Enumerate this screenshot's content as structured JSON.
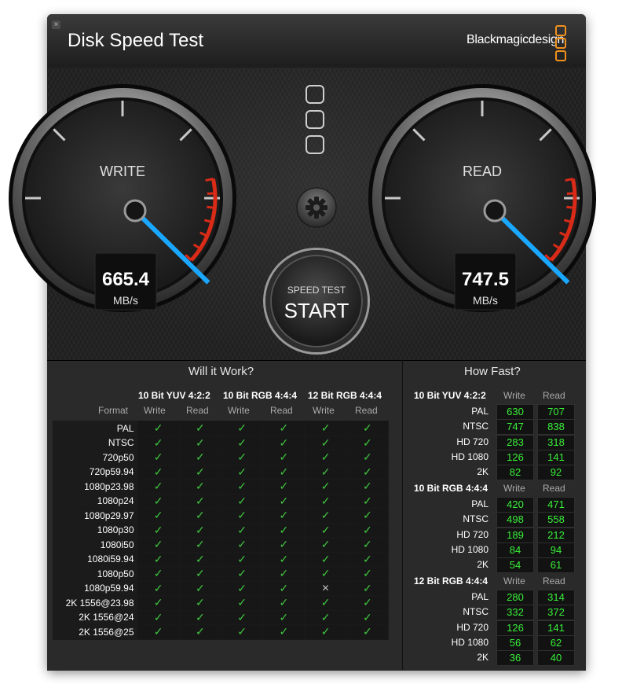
{
  "window": {
    "title": "Disk Speed Test",
    "brand": "Blackmagicdesign",
    "close_glyph": "×"
  },
  "colors": {
    "accent_needle": "#1aa7ff",
    "redline": "#d92b18",
    "ok_green": "#3fc53f",
    "value_green": "#39ef39",
    "logo_orange": "#f0911e"
  },
  "gauges": {
    "write": {
      "label": "WRITE",
      "value": "665.4",
      "unit": "MB/s",
      "fraction": 0.62
    },
    "read": {
      "label": "READ",
      "value": "747.5",
      "unit": "MB/s",
      "fraction": 0.62
    }
  },
  "start": {
    "small": "SPEED TEST",
    "big": "START"
  },
  "icons": {
    "settings": "gear-icon",
    "monitor_boxes": "square-icon",
    "ok": "checkmark-icon",
    "fail": "cross-icon"
  },
  "will_it_work": {
    "title": "Will it Work?",
    "format_label": "Format",
    "groups": [
      "10 Bit YUV 4:2:2",
      "10 Bit RGB 4:4:4",
      "12 Bit RGB 4:4:4"
    ],
    "write_label": "Write",
    "read_label": "Read",
    "rows": [
      {
        "format": "PAL",
        "marks": [
          "ok",
          "ok",
          "ok",
          "ok",
          "ok",
          "ok"
        ]
      },
      {
        "format": "NTSC",
        "marks": [
          "ok",
          "ok",
          "ok",
          "ok",
          "ok",
          "ok"
        ]
      },
      {
        "format": "720p50",
        "marks": [
          "ok",
          "ok",
          "ok",
          "ok",
          "ok",
          "ok"
        ]
      },
      {
        "format": "720p59.94",
        "marks": [
          "ok",
          "ok",
          "ok",
          "ok",
          "ok",
          "ok"
        ]
      },
      {
        "format": "1080p23.98",
        "marks": [
          "ok",
          "ok",
          "ok",
          "ok",
          "ok",
          "ok"
        ]
      },
      {
        "format": "1080p24",
        "marks": [
          "ok",
          "ok",
          "ok",
          "ok",
          "ok",
          "ok"
        ]
      },
      {
        "format": "1080p29.97",
        "marks": [
          "ok",
          "ok",
          "ok",
          "ok",
          "ok",
          "ok"
        ]
      },
      {
        "format": "1080p30",
        "marks": [
          "ok",
          "ok",
          "ok",
          "ok",
          "ok",
          "ok"
        ]
      },
      {
        "format": "1080i50",
        "marks": [
          "ok",
          "ok",
          "ok",
          "ok",
          "ok",
          "ok"
        ]
      },
      {
        "format": "1080i59.94",
        "marks": [
          "ok",
          "ok",
          "ok",
          "ok",
          "ok",
          "ok"
        ]
      },
      {
        "format": "1080p50",
        "marks": [
          "ok",
          "ok",
          "ok",
          "ok",
          "ok",
          "ok"
        ]
      },
      {
        "format": "1080p59.94",
        "marks": [
          "ok",
          "ok",
          "ok",
          "ok",
          "fail",
          "ok"
        ]
      },
      {
        "format": "2K 1556@23.98",
        "marks": [
          "ok",
          "ok",
          "ok",
          "ok",
          "ok",
          "ok"
        ]
      },
      {
        "format": "2K 1556@24",
        "marks": [
          "ok",
          "ok",
          "ok",
          "ok",
          "ok",
          "ok"
        ]
      },
      {
        "format": "2K 1556@25",
        "marks": [
          "ok",
          "ok",
          "ok",
          "ok",
          "ok",
          "ok"
        ]
      }
    ]
  },
  "how_fast": {
    "title": "How Fast?",
    "write_label": "Write",
    "read_label": "Read",
    "groups": [
      {
        "name": "10 Bit YUV 4:2:2",
        "rows": [
          {
            "format": "PAL",
            "write": "630",
            "read": "707"
          },
          {
            "format": "NTSC",
            "write": "747",
            "read": "838"
          },
          {
            "format": "HD 720",
            "write": "283",
            "read": "318"
          },
          {
            "format": "HD 1080",
            "write": "126",
            "read": "141"
          },
          {
            "format": "2K",
            "write": "82",
            "read": "92"
          }
        ]
      },
      {
        "name": "10 Bit RGB 4:4:4",
        "rows": [
          {
            "format": "PAL",
            "write": "420",
            "read": "471"
          },
          {
            "format": "NTSC",
            "write": "498",
            "read": "558"
          },
          {
            "format": "HD 720",
            "write": "189",
            "read": "212"
          },
          {
            "format": "HD 1080",
            "write": "84",
            "read": "94"
          },
          {
            "format": "2K",
            "write": "54",
            "read": "61"
          }
        ]
      },
      {
        "name": "12 Bit RGB 4:4:4",
        "rows": [
          {
            "format": "PAL",
            "write": "280",
            "read": "314"
          },
          {
            "format": "NTSC",
            "write": "332",
            "read": "372"
          },
          {
            "format": "HD 720",
            "write": "126",
            "read": "141"
          },
          {
            "format": "HD 1080",
            "write": "56",
            "read": "62"
          },
          {
            "format": "2K",
            "write": "36",
            "read": "40"
          }
        ]
      }
    ]
  }
}
